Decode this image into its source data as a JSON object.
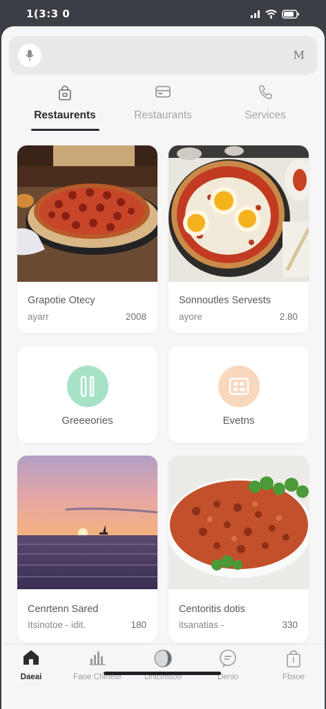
{
  "status_bar": {
    "time": "1(3:3 0"
  },
  "search": {
    "trailing_text": "M"
  },
  "tabs": [
    {
      "label": "Restaurents",
      "icon": "bag-icon",
      "active": true
    },
    {
      "label": "Restaurants",
      "icon": "card-icon",
      "active": false
    },
    {
      "label": "Services",
      "icon": "phone-icon",
      "active": false
    }
  ],
  "cards": [
    {
      "title": "Grapotie Otecy",
      "subtitle": "ayarr",
      "price": "2008",
      "image": "pepperoni-pizza"
    },
    {
      "title": "Sonnoutles Servests",
      "subtitle": "ayore",
      "price": "2.80",
      "image": "egg-pizza"
    },
    {
      "title": "Greeeories",
      "icon": "utensils-icon",
      "color": "#a8e2c6"
    },
    {
      "title": "Evetns",
      "icon": "calendar-icon",
      "color": "#f8d7bd"
    },
    {
      "title": "Cenrtenn Sared",
      "subtitle": "Itsinotoe - idit.",
      "price": "180",
      "image": "sunset-sea"
    },
    {
      "title": "Centoritis dotis",
      "subtitle": "itsanatias -",
      "price": "330",
      "image": "chili-dish"
    }
  ],
  "bottom_nav": [
    {
      "label": "Daeai",
      "icon": "home-icon",
      "active": true
    },
    {
      "label": "Faoe Chmete",
      "icon": "bar-chart-icon",
      "active": false
    },
    {
      "label": "Dnicimsoo",
      "icon": "moon-icon",
      "active": false
    },
    {
      "label": "Denio",
      "icon": "chat-icon",
      "active": false
    },
    {
      "label": "Fbsoe",
      "icon": "bag-icon",
      "active": false
    }
  ],
  "colors": {
    "accent": "#2a2c30",
    "background": "#f6f6f7",
    "green_chip": "#a8e2c6",
    "peach_chip": "#f8d7bd"
  }
}
